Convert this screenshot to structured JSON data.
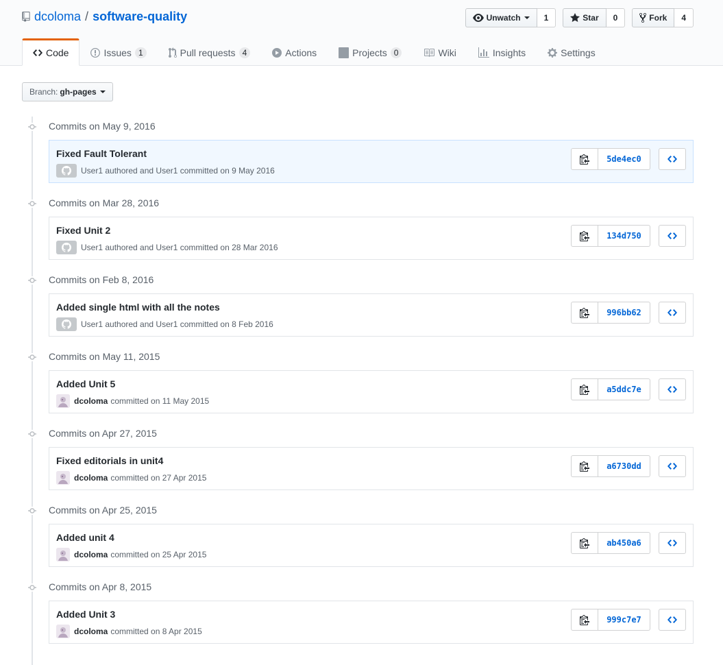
{
  "repo": {
    "owner": "dcoloma",
    "separator": "/",
    "name": "software-quality"
  },
  "actions": {
    "watch": {
      "label": "Unwatch",
      "count": "1"
    },
    "star": {
      "label": "Star",
      "count": "0"
    },
    "fork": {
      "label": "Fork",
      "count": "4"
    }
  },
  "tabs": [
    {
      "label": "Code",
      "icon": "code-icon",
      "counter": null,
      "selected": true
    },
    {
      "label": "Issues",
      "icon": "issue-icon",
      "counter": "1"
    },
    {
      "label": "Pull requests",
      "icon": "pull-request-icon",
      "counter": "4"
    },
    {
      "label": "Actions",
      "icon": "play-icon",
      "counter": null
    },
    {
      "label": "Projects",
      "icon": "project-icon",
      "counter": "0"
    },
    {
      "label": "Wiki",
      "icon": "book-icon",
      "counter": null
    },
    {
      "label": "Insights",
      "icon": "graph-icon",
      "counter": null
    },
    {
      "label": "Settings",
      "icon": "gear-icon",
      "counter": null
    }
  ],
  "branch": {
    "prefix": "Branch:",
    "name": "gh-pages"
  },
  "groups": [
    {
      "date": "Commits on May 9, 2016",
      "commits": [
        {
          "message": "Fixed Fault Tolerant",
          "avatar": "github-avatar",
          "author": "",
          "meta": "User1 authored and User1 committed on 9 May 2016",
          "sha": "5de4ec0",
          "highlight": true
        }
      ]
    },
    {
      "date": "Commits on Mar 28, 2016",
      "commits": [
        {
          "message": "Fixed Unit 2",
          "avatar": "github-avatar",
          "author": "",
          "meta": "User1 authored and User1 committed on 28 Mar 2016",
          "sha": "134d750"
        }
      ]
    },
    {
      "date": "Commits on Feb 8, 2016",
      "commits": [
        {
          "message": "Added single html with all the notes",
          "avatar": "github-avatar",
          "author": "",
          "meta": "User1 authored and User1 committed on 8 Feb 2016",
          "sha": "996bb62"
        }
      ]
    },
    {
      "date": "Commits on May 11, 2015",
      "commits": [
        {
          "message": "Added Unit 5",
          "avatar": "user-avatar",
          "author": "dcoloma",
          "meta": "committed on 11 May 2015",
          "sha": "a5ddc7e"
        }
      ]
    },
    {
      "date": "Commits on Apr 27, 2015",
      "commits": [
        {
          "message": "Fixed editorials in unit4",
          "avatar": "user-avatar",
          "author": "dcoloma",
          "meta": "committed on 27 Apr 2015",
          "sha": "a6730dd"
        }
      ]
    },
    {
      "date": "Commits on Apr 25, 2015",
      "commits": [
        {
          "message": "Added unit 4",
          "avatar": "user-avatar",
          "author": "dcoloma",
          "meta": "committed on 25 Apr 2015",
          "sha": "ab450a6"
        }
      ]
    },
    {
      "date": "Commits on Apr 8, 2015",
      "commits": [
        {
          "message": "Added Unit 3",
          "avatar": "user-avatar",
          "author": "dcoloma",
          "meta": "committed on 8 Apr 2015",
          "sha": "999c7e7"
        }
      ]
    }
  ],
  "colors": {
    "link": "#0366d6",
    "tab_accent": "#e36209",
    "highlight_bg": "#f1f8ff"
  }
}
